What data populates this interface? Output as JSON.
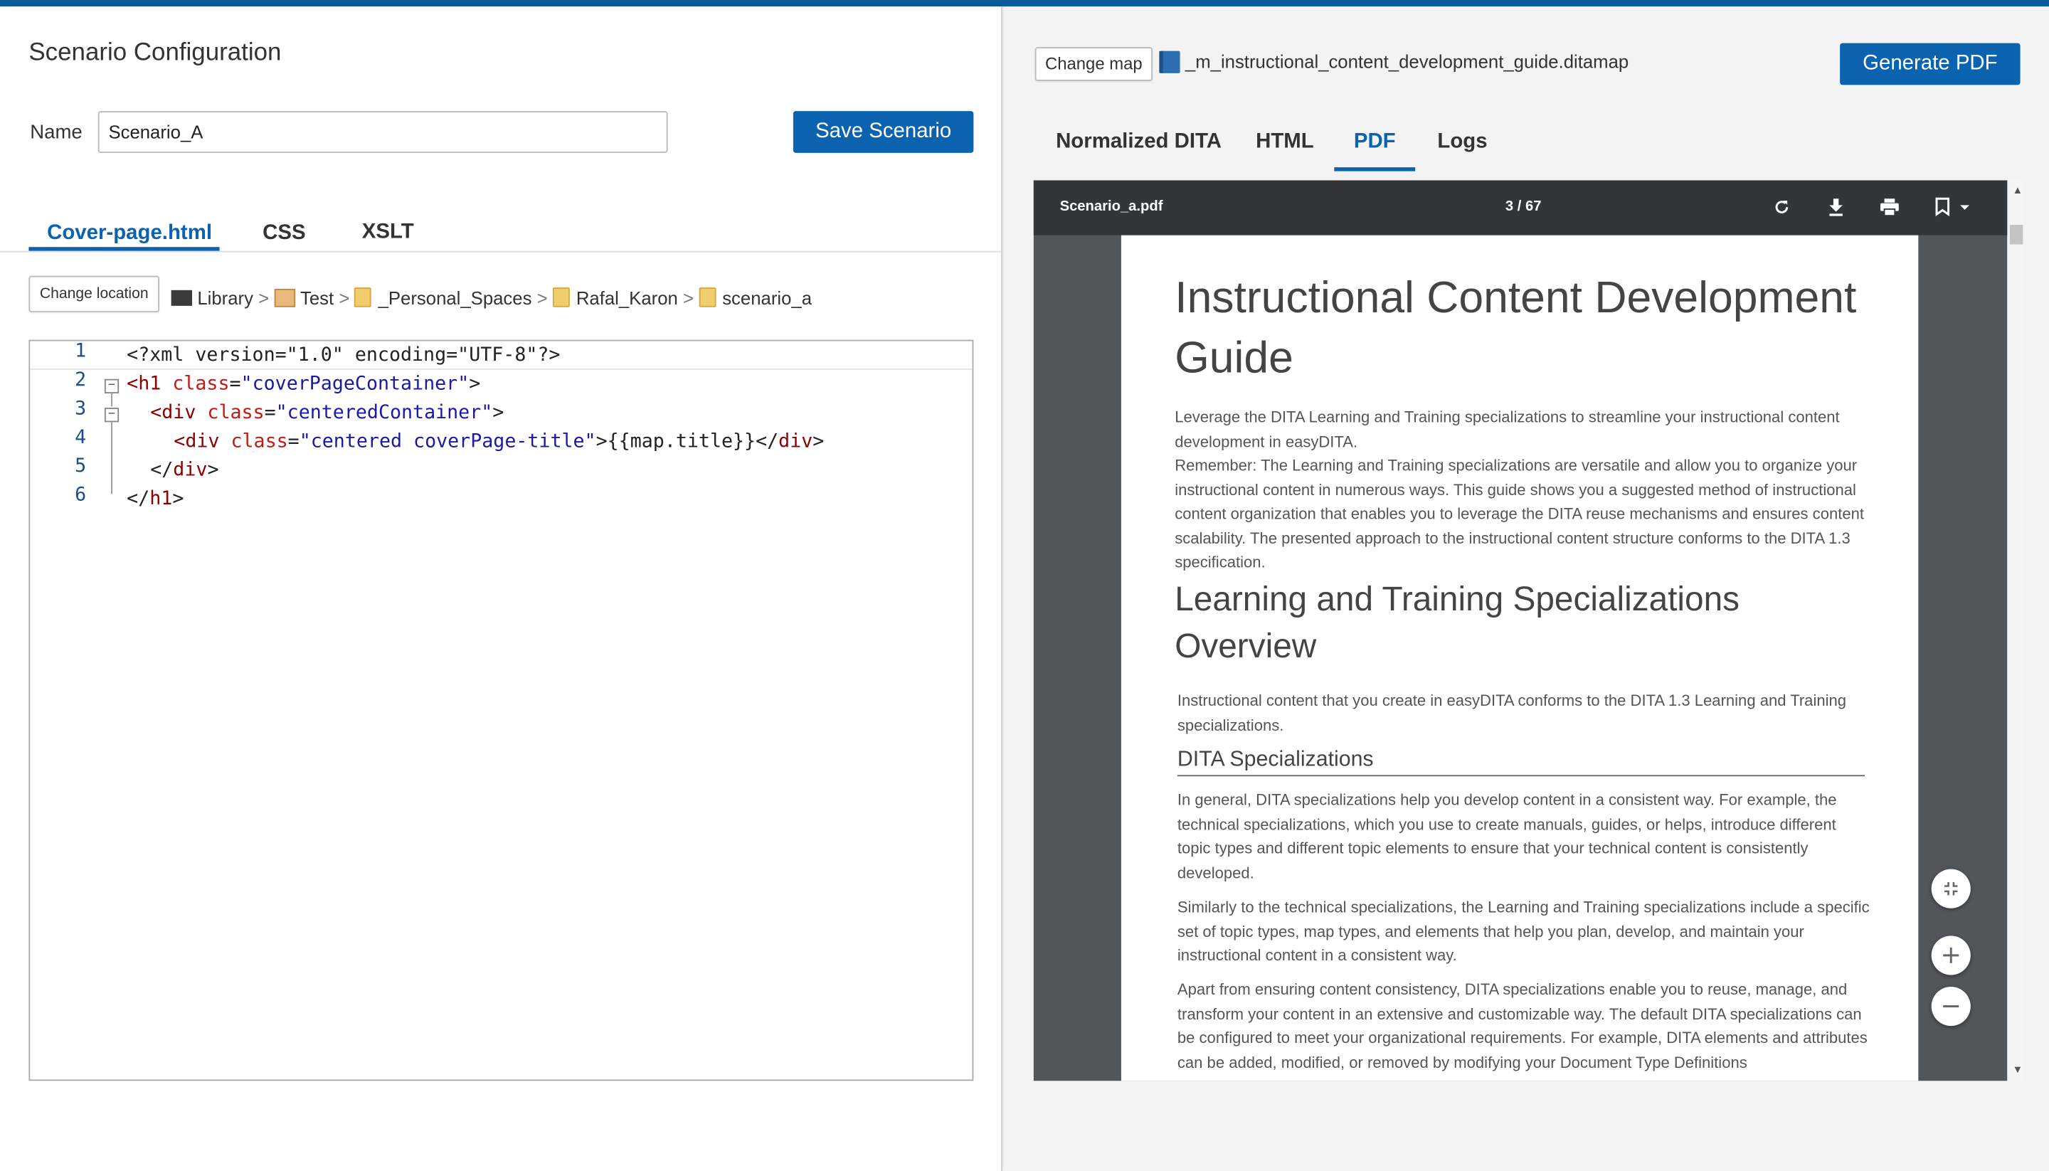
{
  "left": {
    "title": "Scenario Configuration",
    "name_label": "Name",
    "name_value": "Scenario_A",
    "save_button": "Save Scenario",
    "tabs": [
      {
        "label": "Cover-page.html",
        "active": true
      },
      {
        "label": "CSS",
        "active": false
      },
      {
        "label": "XSLT",
        "active": false
      }
    ],
    "change_location": "Change location",
    "breadcrumb": [
      "Library",
      "Test",
      "_Personal_Spaces",
      "Rafal_Karon",
      "scenario_a"
    ],
    "breadcrumb_sep": ">",
    "code_lines": [
      "1",
      "2",
      "3",
      "4",
      "5",
      "6"
    ],
    "code": {
      "l1": "<?xml version=\"1.0\" encoding=\"UTF-8\"?>",
      "l2_open": "<h1",
      "l2_attr": "class",
      "l2_eq": "=",
      "l2_val": "\"coverPageContainer\"",
      "l2_close": ">",
      "l3_open": "<div",
      "l3_attr": "class",
      "l3_eq": "=",
      "l3_val": "\"centeredContainer\"",
      "l3_close": ">",
      "l4_open": "<div",
      "l4_attr": "class",
      "l4_eq": "=",
      "l4_val": "\"centered coverPage-title\"",
      "l4_mid": ">{{map.title}}</",
      "l4_tag": "div",
      "l4_close": ">",
      "l5_open": "</",
      "l5_tag": "div",
      "l5_close": ">",
      "l6_open": "</",
      "l6_tag": "h1",
      "l6_close": ">"
    }
  },
  "right": {
    "change_map": "Change map",
    "map_file": "_m_instructional_content_development_guide.ditamap",
    "generate_button": "Generate PDF",
    "tabs": [
      {
        "label": "Normalized DITA",
        "active": false
      },
      {
        "label": "HTML",
        "active": false
      },
      {
        "label": "PDF",
        "active": true
      },
      {
        "label": "Logs",
        "active": false
      }
    ],
    "pdf": {
      "filename": "Scenario_a.pdf",
      "page_indicator": "3 / 67",
      "title_line1": "Instructional Content Development",
      "title_line2": "Guide",
      "p1": "Leverage the DITA Learning and Training specializations to streamline your instructional content development in easyDITA.",
      "p2": "Remember: The Learning and Training specializations are versatile and allow you to organize your instructional content in numerous ways. This guide shows you a suggested method of instructional content organization that enables you to leverage the DITA reuse mechanisms and ensures content scalability. The presented approach to the instructional content structure conforms to the DITA 1.3 specification.",
      "h2_line1": "Learning and Training Specializations",
      "h2_line2": "Overview",
      "p3": "Instructional content that you create in easyDITA conforms to the DITA 1.3 Learning and Training specializations.",
      "h3": "DITA Specializations",
      "p4": "In general, DITA specializations help you develop content in a consistent way. For example, the technical specializations, which you use to create manuals, guides, or helps, introduce different topic types and different topic elements to ensure that your technical content is consistently developed.",
      "p5": "Similarly to the technical specializations, the Learning and Training specializations include a specific set of topic types, map types, and elements that help you plan, develop, and maintain your instructional content in a consistent way.",
      "p6": "Apart from ensuring content consistency, DITA specializations enable you to reuse, manage, and transform your content in an extensive and customizable way. The default DITA specializations can be configured to meet your organizational requirements. For example, DITA elements and attributes can be added, modified, or removed by modifying your Document Type Definitions"
    }
  },
  "colors": {
    "accent": "#0b63b0",
    "pdf_toolbar": "#323639",
    "pdf_background": "#525659"
  }
}
